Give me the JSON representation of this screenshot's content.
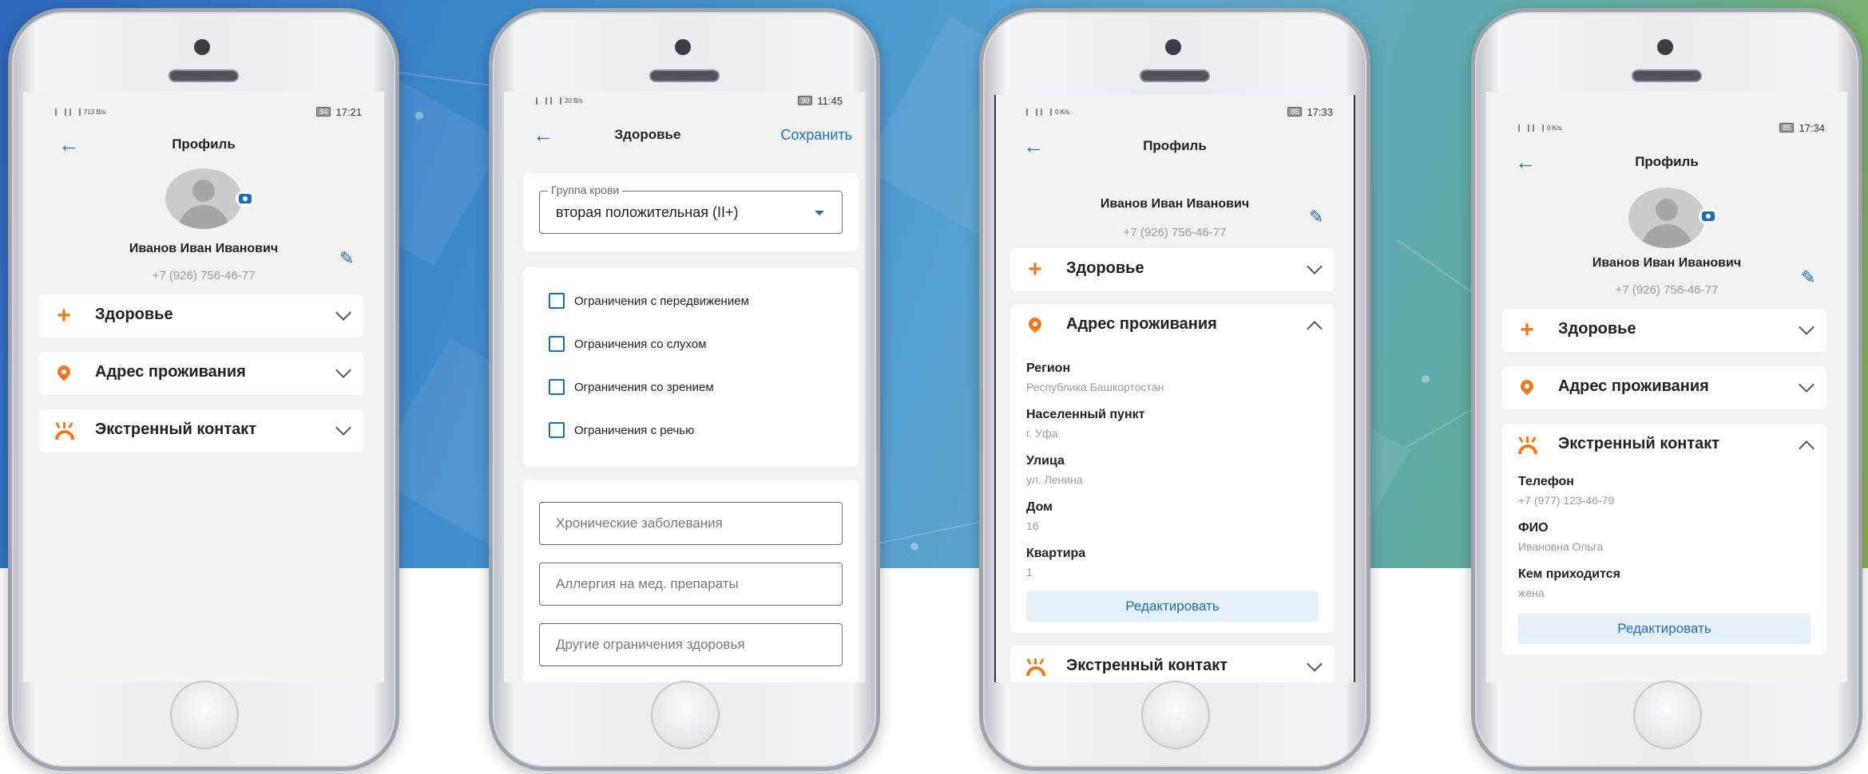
{
  "colors": {
    "accent": "#1f6db3",
    "orange": "#f0781e",
    "muted": "#9a9a9a"
  },
  "phones": [
    {
      "status": {
        "left": "713 B/s",
        "time": "17:21",
        "battery": "94"
      },
      "header": {
        "title": "Профиль"
      },
      "user": {
        "name": "Иванов Иван Иванович",
        "phone": "+7 (926) 756-46-77"
      },
      "sections": [
        {
          "label": "Здоровье",
          "icon": "plus-icon"
        },
        {
          "label": "Адрес проживания",
          "icon": "location-pin-icon"
        },
        {
          "label": "Экстренный контакт",
          "icon": "emergency-phone-icon"
        }
      ]
    },
    {
      "status": {
        "left": "20 B/s",
        "time": "11:45",
        "battery": "90"
      },
      "header": {
        "title": "Здоровье",
        "save": "Сохранить"
      },
      "blood": {
        "label": "Группа крови",
        "value": "вторая положительная (II+)"
      },
      "checkboxes": [
        "Ограничения с передвижением",
        "Ограничения со слухом",
        "Ограничения со зрением",
        "Ограничения с речью"
      ],
      "inputs": [
        "Хронические заболевания",
        "Аллергия на мед. препараты",
        "Другие ограничения здоровья"
      ]
    },
    {
      "status": {
        "left": "0 K/s",
        "time": "17:33",
        "battery": "85"
      },
      "header": {
        "title": "Профиль"
      },
      "user": {
        "name": "Иванов Иван Иванович",
        "phone": "+7 (926) 756-46-77"
      },
      "sections": [
        {
          "label": "Здоровье"
        },
        {
          "label": "Адрес проживания"
        },
        {
          "label": "Экстренный контакт"
        }
      ],
      "address": [
        {
          "label": "Регион",
          "value": "Республика Башкортостан"
        },
        {
          "label": "Населенный пункт",
          "value": "г. Уфа"
        },
        {
          "label": "Улица",
          "value": "ул. Ленина"
        },
        {
          "label": "Дом",
          "value": "16"
        },
        {
          "label": "Квартира",
          "value": "1"
        }
      ],
      "edit": "Редактировать"
    },
    {
      "status": {
        "left": "0 K/s",
        "time": "17:34",
        "battery": "85"
      },
      "header": {
        "title": "Профиль"
      },
      "user": {
        "name": "Иванов Иван Иванович",
        "phone": "+7 (926) 756-46-77"
      },
      "sections": [
        {
          "label": "Здоровье"
        },
        {
          "label": "Адрес проживания"
        },
        {
          "label": "Экстренный контакт"
        }
      ],
      "contact": [
        {
          "label": "Телефон",
          "value": "+7 (977) 123-46-79"
        },
        {
          "label": "ФИО",
          "value": "Ивановна Ольга"
        },
        {
          "label": "Кем приходится",
          "value": "жена"
        }
      ],
      "edit": "Редактировать"
    }
  ]
}
